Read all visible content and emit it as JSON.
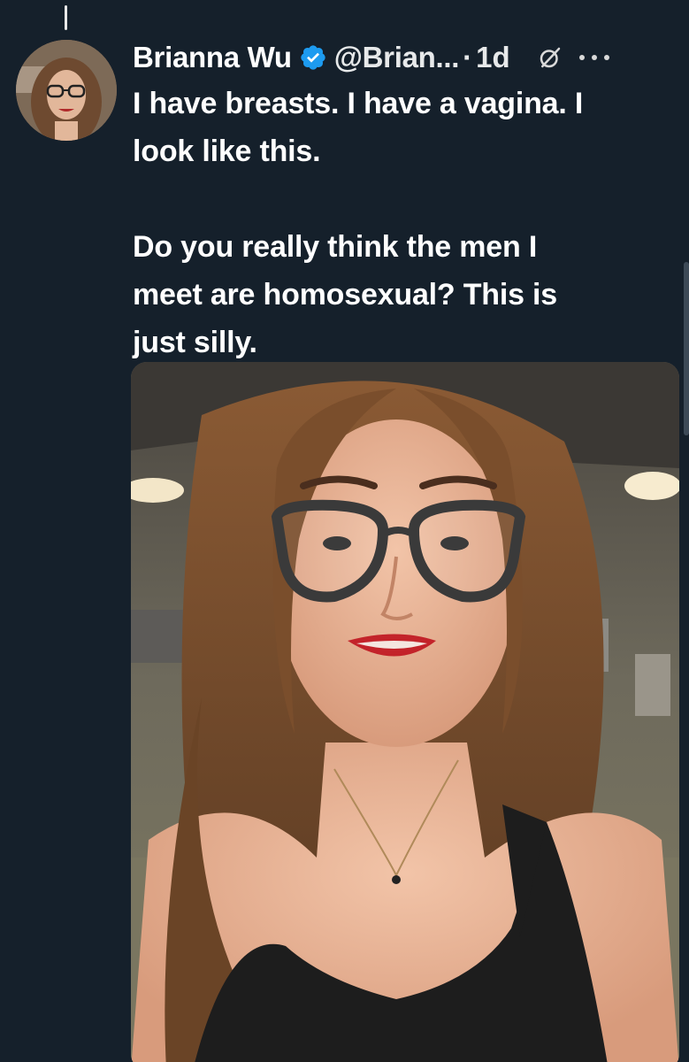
{
  "tweet": {
    "author_name": "Brianna Wu",
    "handle": "@Brian...",
    "separator": "·",
    "time": "1d",
    "paragraph1_line1": "I have breasts. I have a vagina. I",
    "paragraph1_line2": "look like this.",
    "paragraph2_line1": "Do you really think the men I",
    "paragraph2_line2": "meet are homosexual? This is",
    "paragraph2_line3": "just silly."
  },
  "icons": {
    "verified": "verified-badge-icon",
    "grok": "grok-icon",
    "more": "more-options-icon"
  },
  "colors": {
    "background": "#15202b",
    "verified_blue": "#1d9bf0",
    "text": "#ffffff"
  }
}
